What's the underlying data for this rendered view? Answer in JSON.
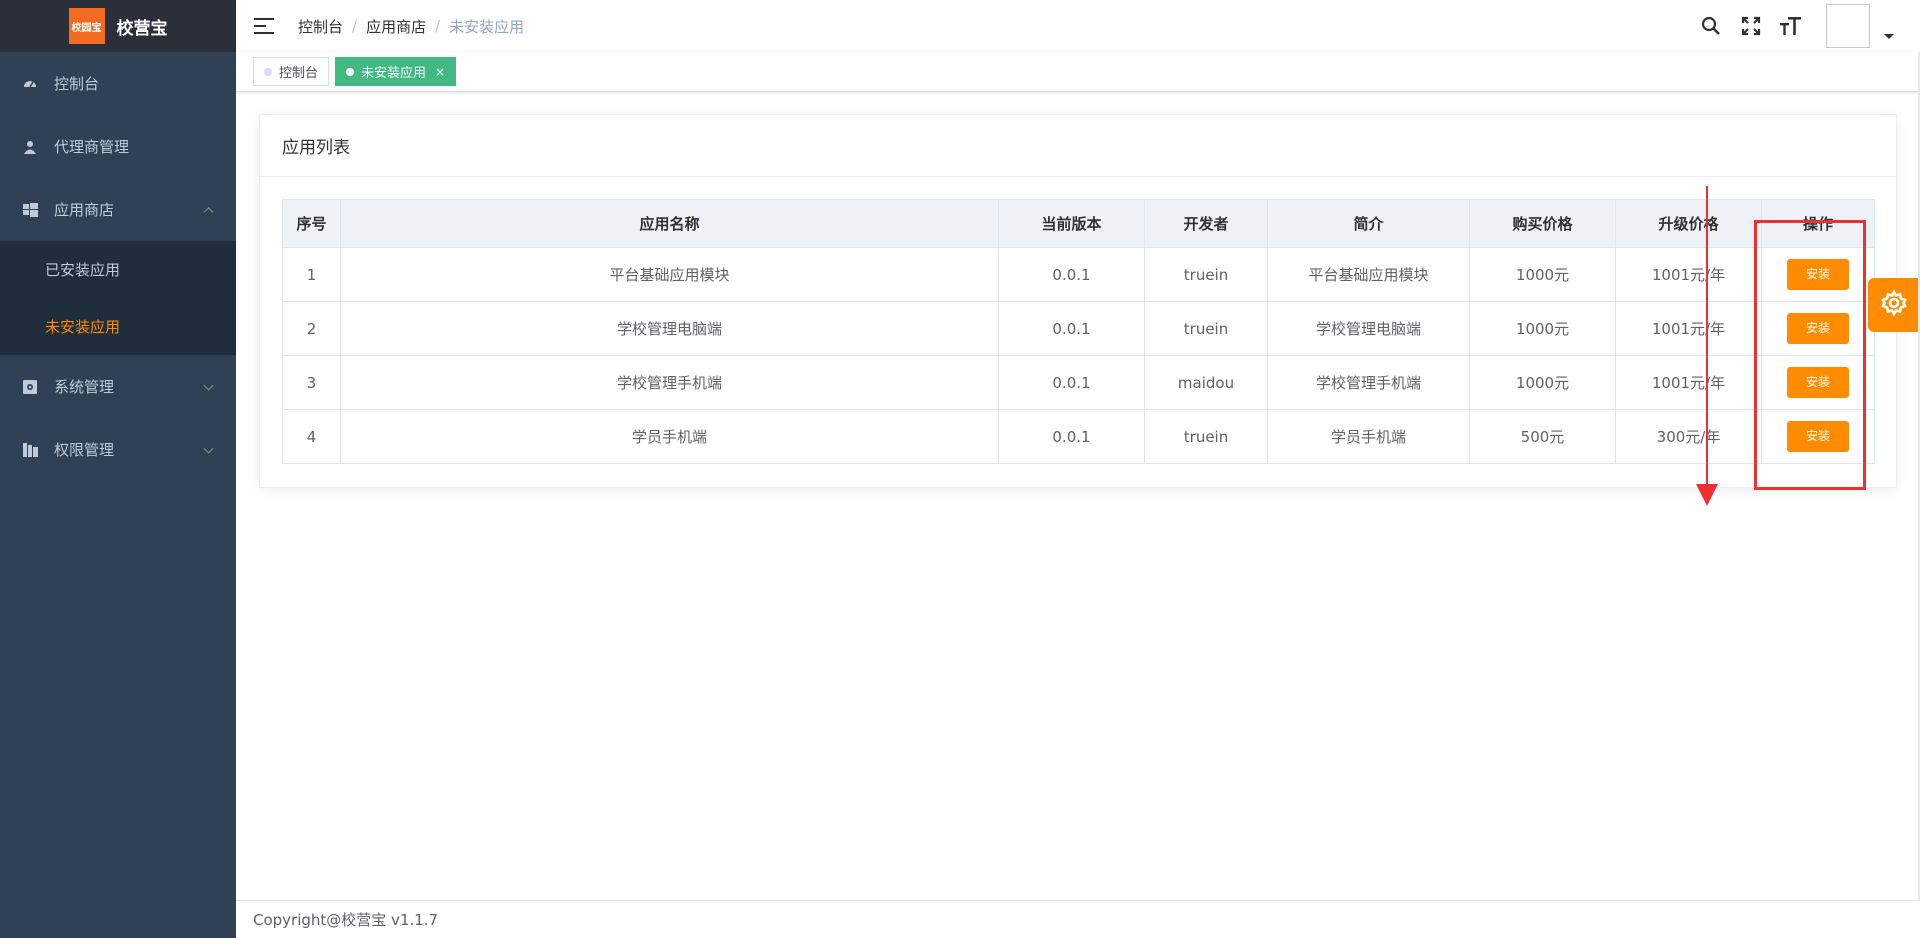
{
  "brand": {
    "logo_text": "校园宝",
    "name": "校营宝"
  },
  "sidebar": {
    "items": [
      {
        "label": "控制台",
        "icon": "dashboard-icon"
      },
      {
        "label": "代理商管理",
        "icon": "user-icon"
      },
      {
        "label": "应用商店",
        "icon": "windows-icon",
        "expanded": true,
        "children": [
          {
            "label": "已安装应用"
          },
          {
            "label": "未安装应用",
            "active": true
          }
        ]
      },
      {
        "label": "系统管理",
        "icon": "settings-box-icon"
      },
      {
        "label": "权限管理",
        "icon": "permission-icon"
      }
    ]
  },
  "header": {
    "breadcrumb": [
      "控制台",
      "应用商店",
      "未安装应用"
    ],
    "icons": [
      "search-icon",
      "fullscreen-icon",
      "font-size-icon"
    ]
  },
  "tags": [
    {
      "label": "控制台",
      "active": false
    },
    {
      "label": "未安装应用",
      "active": true,
      "close": "×"
    }
  ],
  "card": {
    "title": "应用列表",
    "columns": [
      "序号",
      "应用名称",
      "当前版本",
      "开发者",
      "简介",
      "购买价格",
      "升级价格",
      "操作"
    ],
    "rows": [
      {
        "index": "1",
        "name": "平台基础应用模块",
        "version": "0.0.1",
        "developer": "truein",
        "intro": "平台基础应用模块",
        "price": "1000元",
        "upgrade": "1001元/年",
        "action": "安装"
      },
      {
        "index": "2",
        "name": "学校管理电脑端",
        "version": "0.0.1",
        "developer": "truein",
        "intro": "学校管理电脑端",
        "price": "1000元",
        "upgrade": "1001元/年",
        "action": "安装"
      },
      {
        "index": "3",
        "name": "学校管理手机端",
        "version": "0.0.1",
        "developer": "maidou",
        "intro": "学校管理手机端",
        "price": "1000元",
        "upgrade": "1001元/年",
        "action": "安装"
      },
      {
        "index": "4",
        "name": "学员手机端",
        "version": "0.0.1",
        "developer": "truein",
        "intro": "学员手机端",
        "price": "500元",
        "upgrade": "300元/年",
        "action": "安装"
      }
    ]
  },
  "footer": {
    "text": "Copyright@校营宝 v1.1.7"
  },
  "colors": {
    "sidebar_bg": "#304156",
    "accent": "#ff8c00",
    "tag_active": "#42b983",
    "annotation": "#f03030"
  }
}
